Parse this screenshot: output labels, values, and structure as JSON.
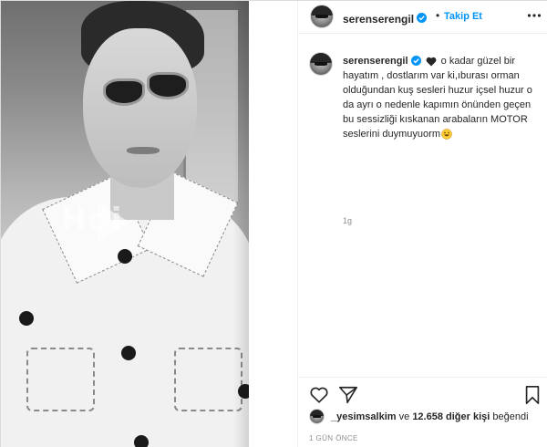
{
  "header": {
    "username": "serenserengil",
    "separator": "•",
    "follow_label": "Takip Et"
  },
  "media": {
    "watermark": "Hdi"
  },
  "caption": {
    "username": "serenserengil",
    "text": "o kadar güzel bir hayatım , dostlarım var ki,ıburası orman olduğundan kuş sesleri huzur içsel huzur o da ayrı o nedenle kapımın önünden geçen bu sessizliği kıskanan arabaların MOTOR seslerini duymuyuorm",
    "emoji": "grinning-face-emoji",
    "time": "1g"
  },
  "likes": {
    "liker": "_yesimsalkim",
    "connector": "ve",
    "others": "12.658 diğer kişi",
    "suffix": "beğendi"
  },
  "post_time": "1 GÜN ÖNCE",
  "colors": {
    "accent": "#0095f6",
    "text": "#262626",
    "muted": "#8e8e8e",
    "border": "#dbdbdb"
  },
  "icons": [
    "more-options-icon",
    "verified-badge-icon",
    "heart-icon",
    "share-icon",
    "bookmark-icon",
    "play-icon"
  ]
}
